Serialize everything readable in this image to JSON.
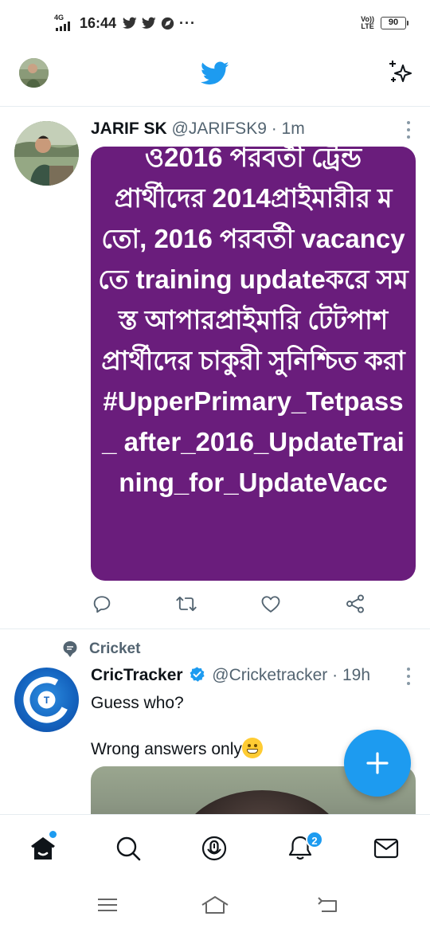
{
  "status_bar": {
    "network": "4G",
    "time": "16:44",
    "overflow": "···",
    "volte_line1": "Vo))",
    "volte_line2": "LTE",
    "battery": "90",
    "battery_level": 0.9,
    "notification_icons": [
      "twitter-icon",
      "twitter-icon",
      "compass-icon"
    ]
  },
  "header": {
    "logo_icon": "twitter-bird-icon",
    "action_icon": "sparkle-icon",
    "brand_color": "#1d9bf0"
  },
  "tweets": [
    {
      "name": "JARIF SK",
      "handle": "@JARIFSK9",
      "time": "· 1m",
      "media_text": "ও2016 পরবর্তী ট্রেন্ড প্রার্থীদের 2014প্রাইমারীর মতো, 2016 পরবর্তী vacancy তে training updateকরে সমস্ত আপারপ্রাইমারি টেটপাশ প্রার্থীদের চাকুরী সুনিশ্চিত করা #UpperPrimary_Tetpass_ after_2016_UpdateTraining_for_UpdateVacc",
      "media_color": "#6a1d7c",
      "actions": [
        "reply-icon",
        "retweet-icon",
        "like-icon",
        "share-icon"
      ]
    },
    {
      "topic": "Cricket",
      "name": "CricTracker",
      "verified": true,
      "handle": "@Cricketracker",
      "time": "· 19h",
      "text_line1": "Guess who?",
      "text_line2": "Wrong answers only",
      "emoji": "grinning-face-icon"
    }
  ],
  "fab": {
    "icon": "plus-icon"
  },
  "bottom_nav": {
    "items": [
      "home-icon",
      "search-icon",
      "spaces-icon",
      "notifications-icon",
      "messages-icon"
    ],
    "notification_count": "2"
  },
  "system_nav": [
    "menu-icon",
    "home-outline-icon",
    "back-icon"
  ]
}
